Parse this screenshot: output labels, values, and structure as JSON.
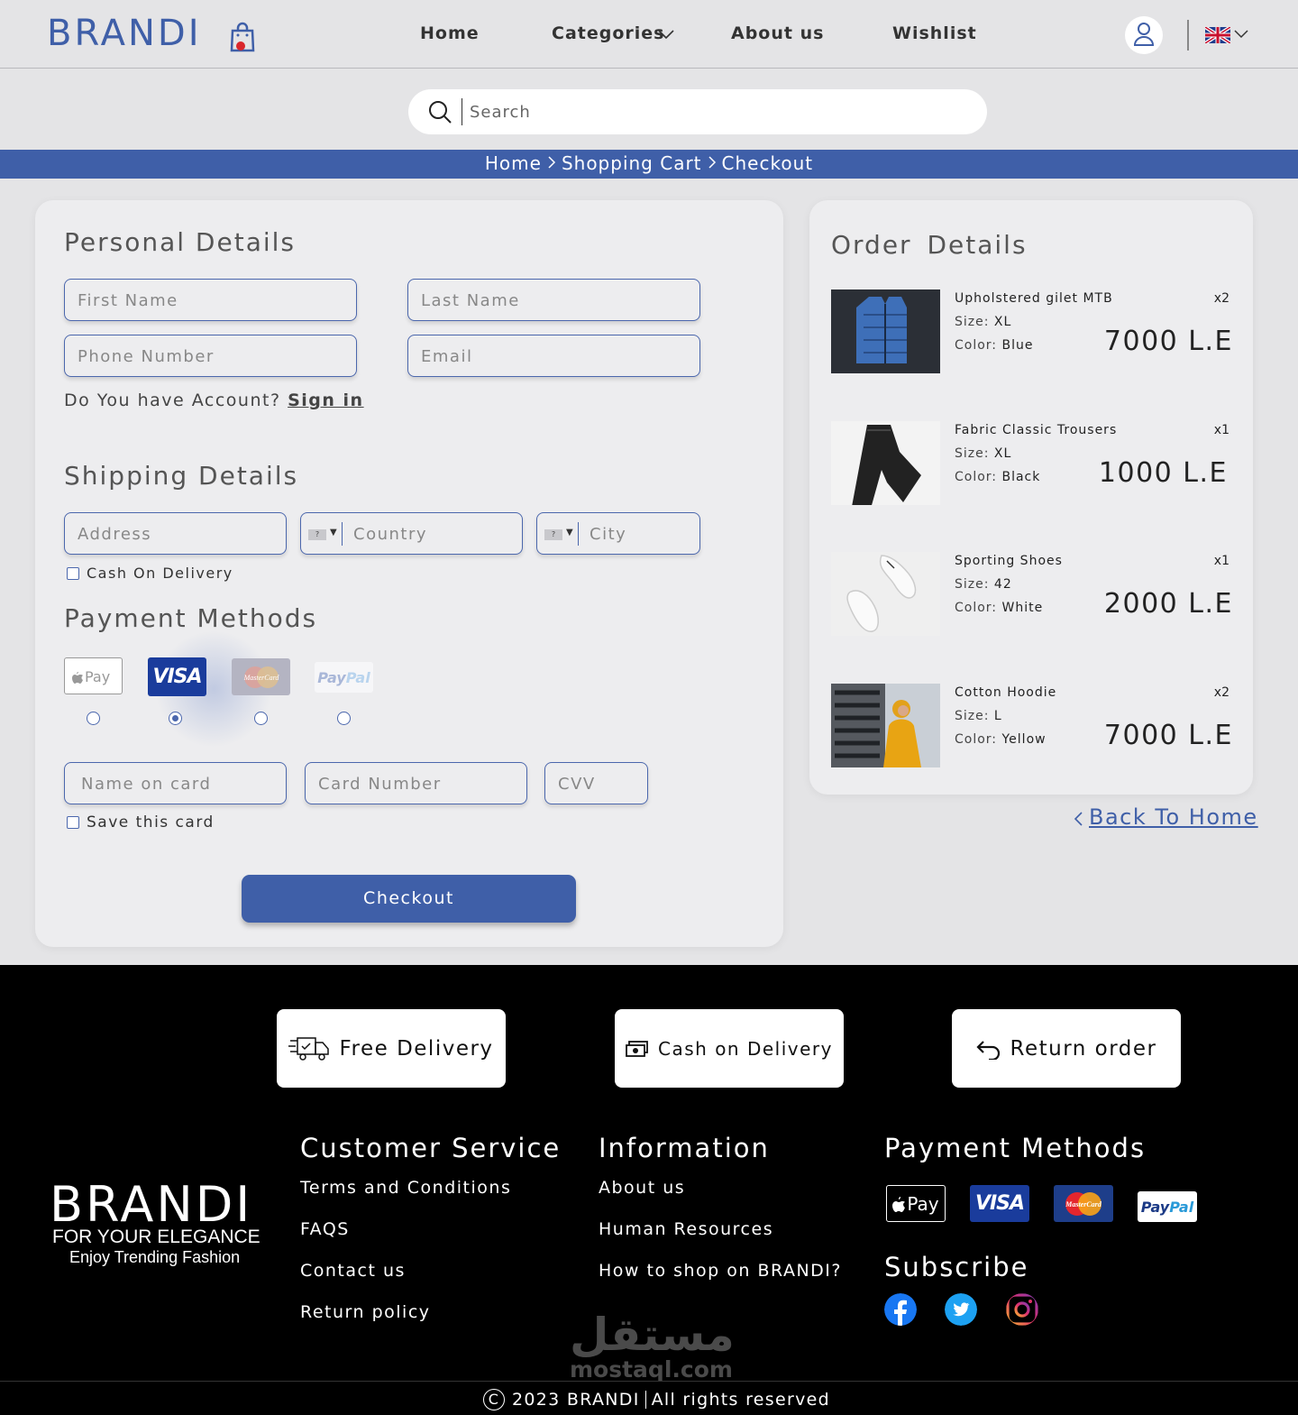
{
  "header": {
    "logo": "BRANDI",
    "nav": {
      "home": "Home",
      "categories": "Categories",
      "about": "About us",
      "wishlist": "Wishlist"
    }
  },
  "search": {
    "placeholder": "Search"
  },
  "breadcrumb": {
    "home": "Home",
    "cart": "Shopping Cart",
    "checkout": "Checkout"
  },
  "personal": {
    "title": "Personal Details",
    "first_name": "First Name",
    "last_name": "Last Name",
    "phone": "Phone Number",
    "email": "Email",
    "account_q": "Do You have Account?",
    "sign_in": "Sign in"
  },
  "shipping": {
    "title": "Shipping Details",
    "address": "Address",
    "country": "Country",
    "city": "City",
    "cod": "Cash On Delivery"
  },
  "payment": {
    "title": "Payment Methods",
    "methods": [
      "Apple Pay",
      "VISA",
      "MasterCard",
      "PayPal"
    ],
    "selected": "VISA",
    "name_on_card": "Name on card",
    "card_number": "Card Number",
    "cvv": "CVV",
    "save_card": "Save this card",
    "checkout": "Checkout"
  },
  "order": {
    "title": "Order Details",
    "items": [
      {
        "name": "Upholstered gilet MTB",
        "qty": "x2",
        "size_label": "Size:",
        "size": "XL",
        "color_label": "Color:",
        "color": "Blue",
        "price": "7000 L.E"
      },
      {
        "name": "Fabric Classic Trousers",
        "qty": "x1",
        "size_label": "Size:",
        "size": "XL",
        "color_label": "Color:",
        "color": "Black",
        "price": "1000 L.E"
      },
      {
        "name": "Sporting Shoes",
        "qty": "x1",
        "size_label": "Size:",
        "size": "42",
        "color_label": "Color:",
        "color": "White",
        "price": "2000 L.E"
      },
      {
        "name": "Cotton Hoodie",
        "qty": "x2",
        "size_label": "Size:",
        "size": "L",
        "color_label": "Color:",
        "color": "Yellow",
        "price": "7000 L.E"
      }
    ]
  },
  "back_home": "Back To Home",
  "footer": {
    "features": {
      "delivery": "Free Delivery",
      "cash": "Cash on Delivery",
      "return": "Return order"
    },
    "logo": "BRANDI",
    "tagline1": "FOR YOUR ELEGANCE",
    "tagline2": "Enjoy Trending Fashion",
    "customer_service": {
      "title": "Customer Service",
      "links": [
        "Terms and Conditions",
        "FAQS",
        "Contact us",
        "Return policy"
      ]
    },
    "information": {
      "title": "Information",
      "links": [
        "About us",
        "Human Resources",
        "How to shop on BRANDI?"
      ]
    },
    "payment_title": "Payment Methods",
    "payment_logos": {
      "apple": "Pay",
      "visa": "VISA",
      "mastercard": "MasterCard",
      "paypal": "PayPal"
    },
    "subscribe": "Subscribe",
    "watermark_ar": "مستقل",
    "watermark_en": "mostaql.com",
    "copyright_year": "2023 BRANDI",
    "copyright_text": "All rights reserved"
  },
  "colors": {
    "brand": "#3f5fa8",
    "background": "#e4e4e6",
    "card": "#ededef",
    "footer": "#000000"
  }
}
